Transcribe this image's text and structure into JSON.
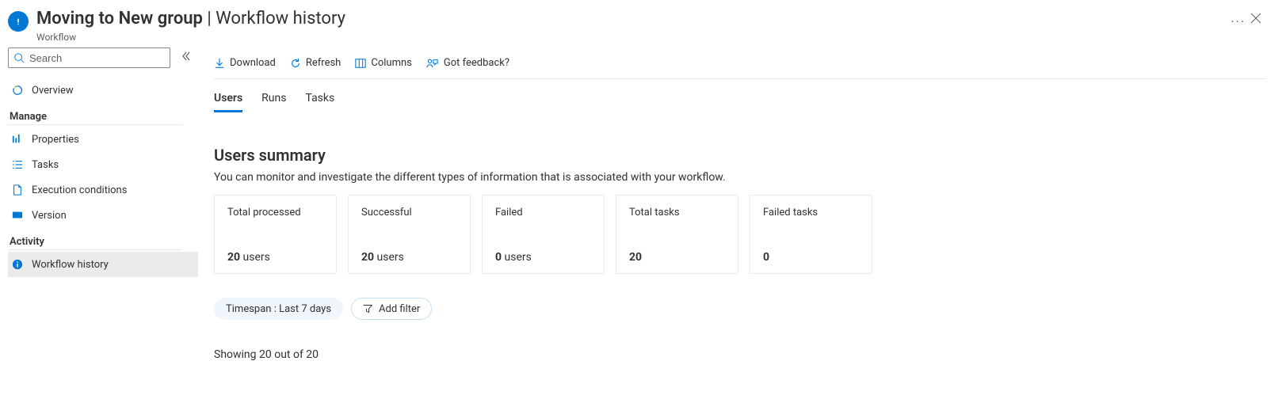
{
  "header": {
    "title_main": "Moving to New group",
    "title_sep": " | ",
    "title_page": "Workflow history",
    "subtitle": "Workflow"
  },
  "sidebar": {
    "search_placeholder": "Search",
    "overview": "Overview",
    "section_manage": "Manage",
    "manage_items": {
      "properties": "Properties",
      "tasks": "Tasks",
      "execution_conditions": "Execution conditions",
      "version": "Version"
    },
    "section_activity": "Activity",
    "activity_items": {
      "workflow_history": "Workflow history"
    }
  },
  "toolbar": {
    "download": "Download",
    "refresh": "Refresh",
    "columns": "Columns",
    "feedback": "Got feedback?"
  },
  "tabs": {
    "users": "Users",
    "runs": "Runs",
    "tasks": "Tasks"
  },
  "summary": {
    "heading": "Users summary",
    "description": "You can monitor and investigate the different types of information that is associated with your workflow.",
    "cards": {
      "total_processed": {
        "label": "Total processed",
        "value": "20",
        "unit": " users"
      },
      "successful": {
        "label": "Successful",
        "value": "20",
        "unit": " users"
      },
      "failed": {
        "label": "Failed",
        "value": "0",
        "unit": " users"
      },
      "total_tasks": {
        "label": "Total tasks",
        "value": "20",
        "unit": ""
      },
      "failed_tasks": {
        "label": "Failed tasks",
        "value": "0",
        "unit": ""
      }
    }
  },
  "filters": {
    "timespan": "Timespan : Last 7 days",
    "add_filter": "Add filter"
  },
  "results": {
    "showing": "Showing 20 out of 20"
  }
}
